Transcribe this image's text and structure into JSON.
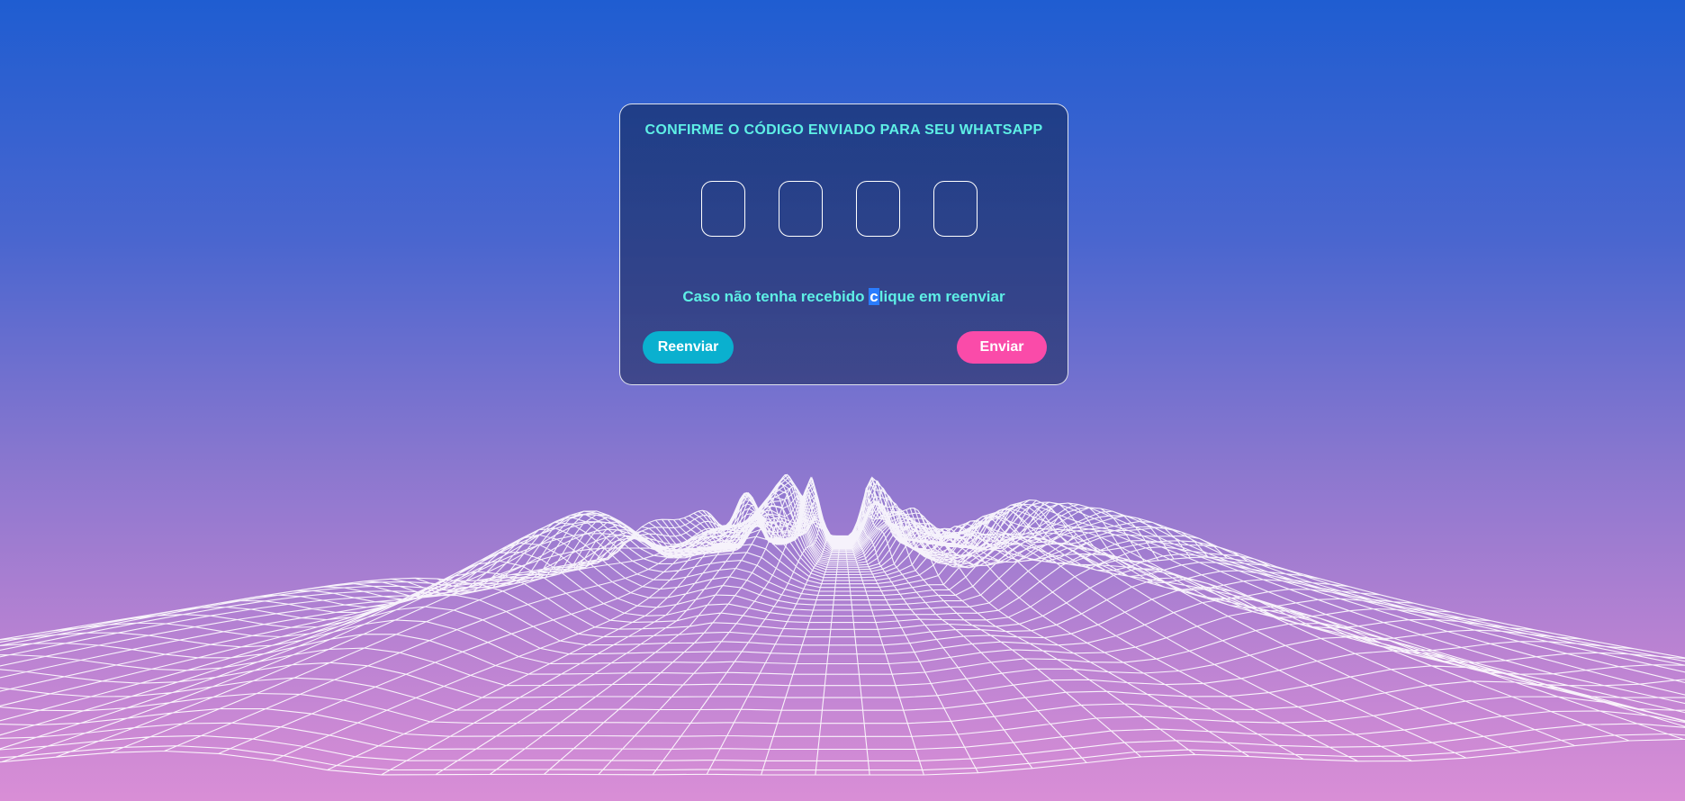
{
  "dialog": {
    "title": "CONFIRME O CÓDIGO ENVIADO PARA SEU WHATSAPP",
    "code_fields": [
      "",
      "",
      "",
      ""
    ],
    "hint_before": "Caso não tenha recebido ",
    "hint_selected": "c",
    "hint_after": "lique em reenviar",
    "resend_label": "Reenviar",
    "send_label": "Enviar"
  },
  "colors": {
    "title_text": "#5ef0e6",
    "resend_button": "#0ab0cf",
    "send_button": "#fa4ba9",
    "background_top": "#1f5dd1",
    "background_bottom": "#d98ed6",
    "grid_lines": "#ffffff"
  },
  "background": {
    "decoration": "wireframe-mountain-landscape"
  }
}
